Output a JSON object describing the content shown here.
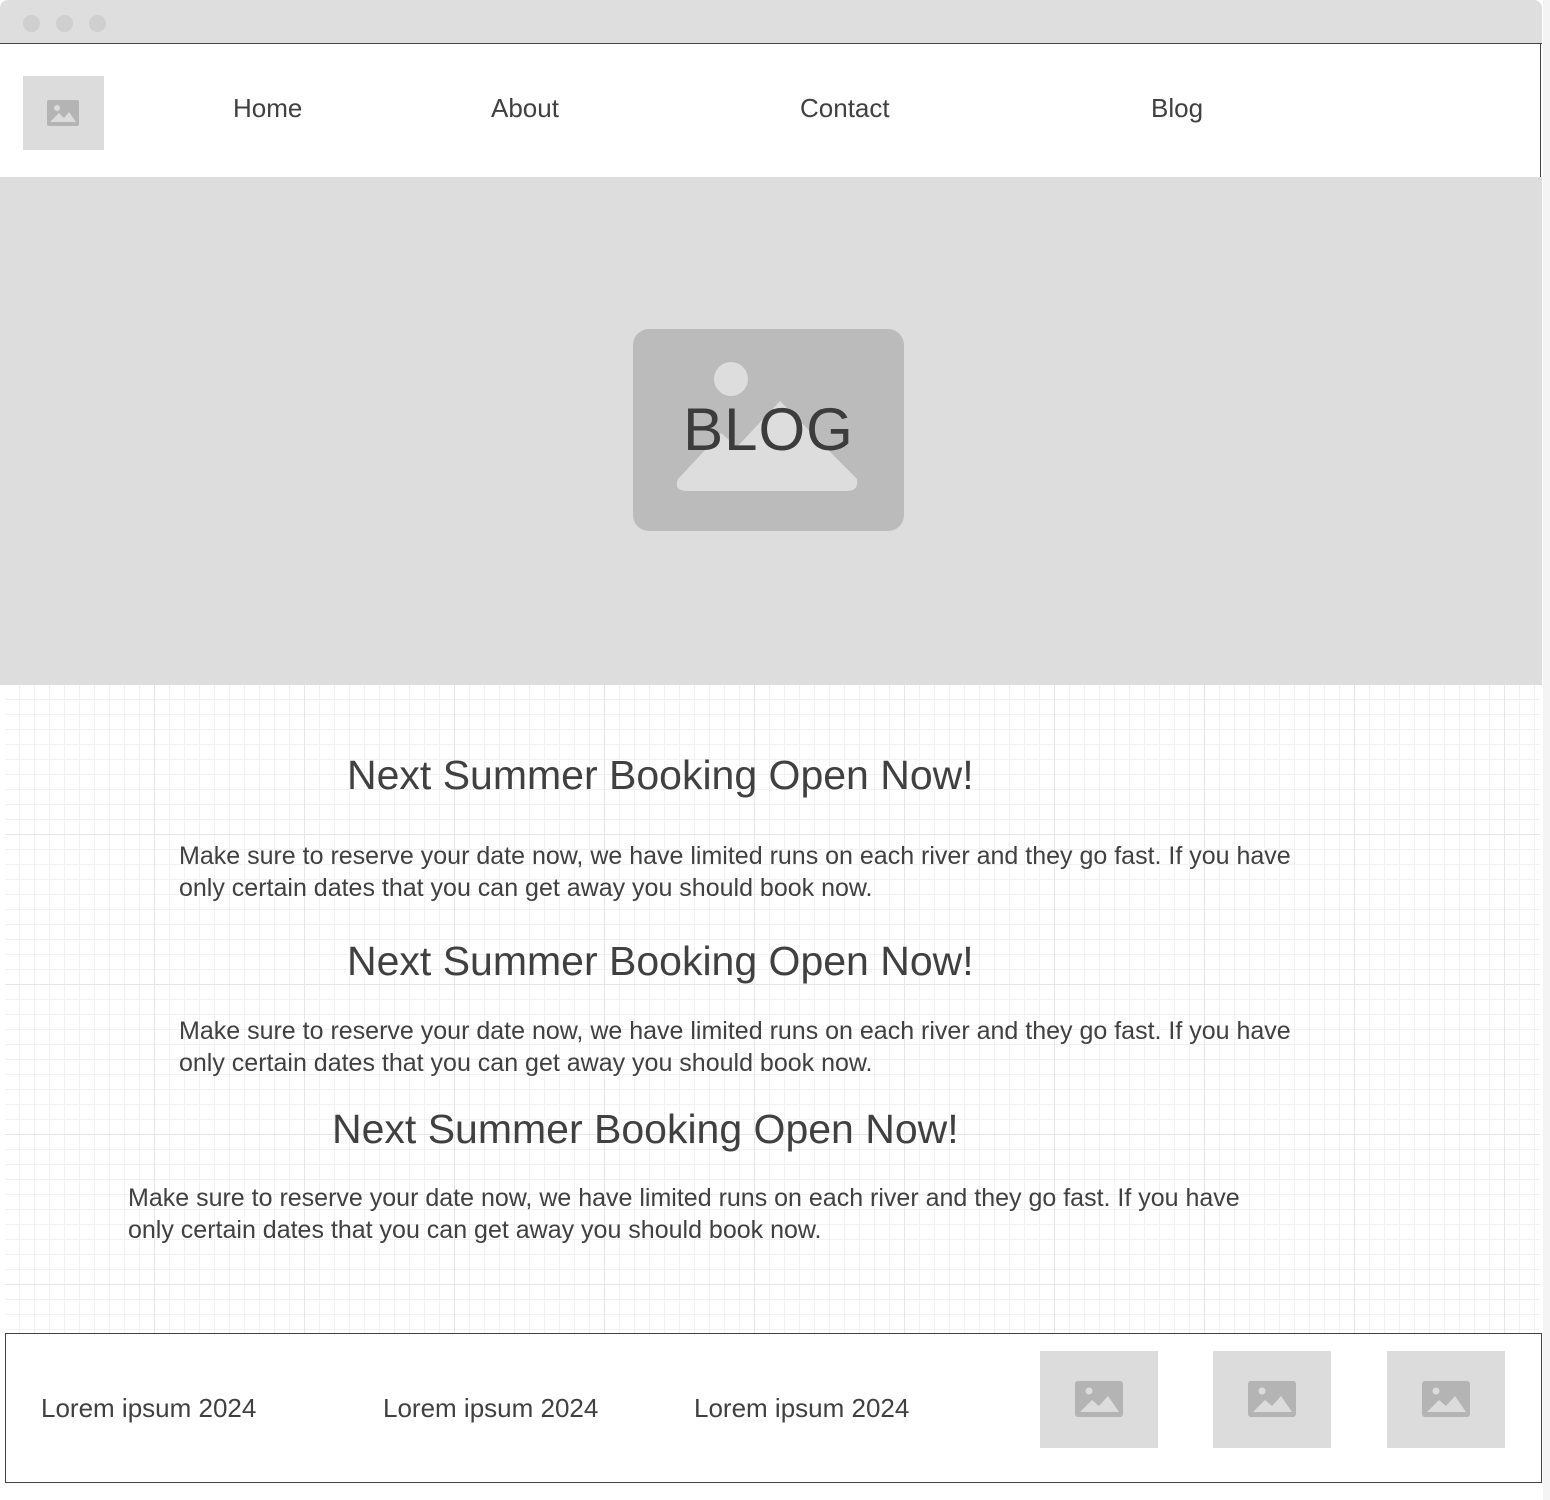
{
  "nav": {
    "logo_icon": "image-placeholder-icon",
    "items": [
      {
        "label": "Home"
      },
      {
        "label": "About"
      },
      {
        "label": "Contact"
      },
      {
        "label": "Blog"
      }
    ]
  },
  "hero": {
    "title": "BLOG",
    "image_icon": "image-placeholder-icon"
  },
  "posts": [
    {
      "heading": "Next Summer Booking Open Now!",
      "body": "Make sure to reserve your date now, we have limited runs on each river and they go fast. If you have only certain dates that you can get away you should book now."
    },
    {
      "heading": "Next Summer Booking Open Now!",
      "body": "Make sure to reserve your date now, we have limited runs on each river and they go fast. If you have only certain dates that you can get away you should book now."
    },
    {
      "heading": "Next Summer Booking Open Now!",
      "body": "Make sure to reserve your date now, we have limited runs on each river and they go fast. If you have only certain dates that you can get away you should book now."
    }
  ],
  "footer": {
    "texts": [
      "Lorem ipsum 2024",
      "Lorem ipsum 2024",
      "Lorem ipsum 2024"
    ],
    "thumbnail_icons": [
      "image-placeholder-icon",
      "image-placeholder-icon",
      "image-placeholder-icon"
    ]
  },
  "colors": {
    "chrome": "#dedede",
    "placeholder": "#dcdcdc",
    "placeholder_icon": "#bbbbbb",
    "text": "#404040"
  }
}
